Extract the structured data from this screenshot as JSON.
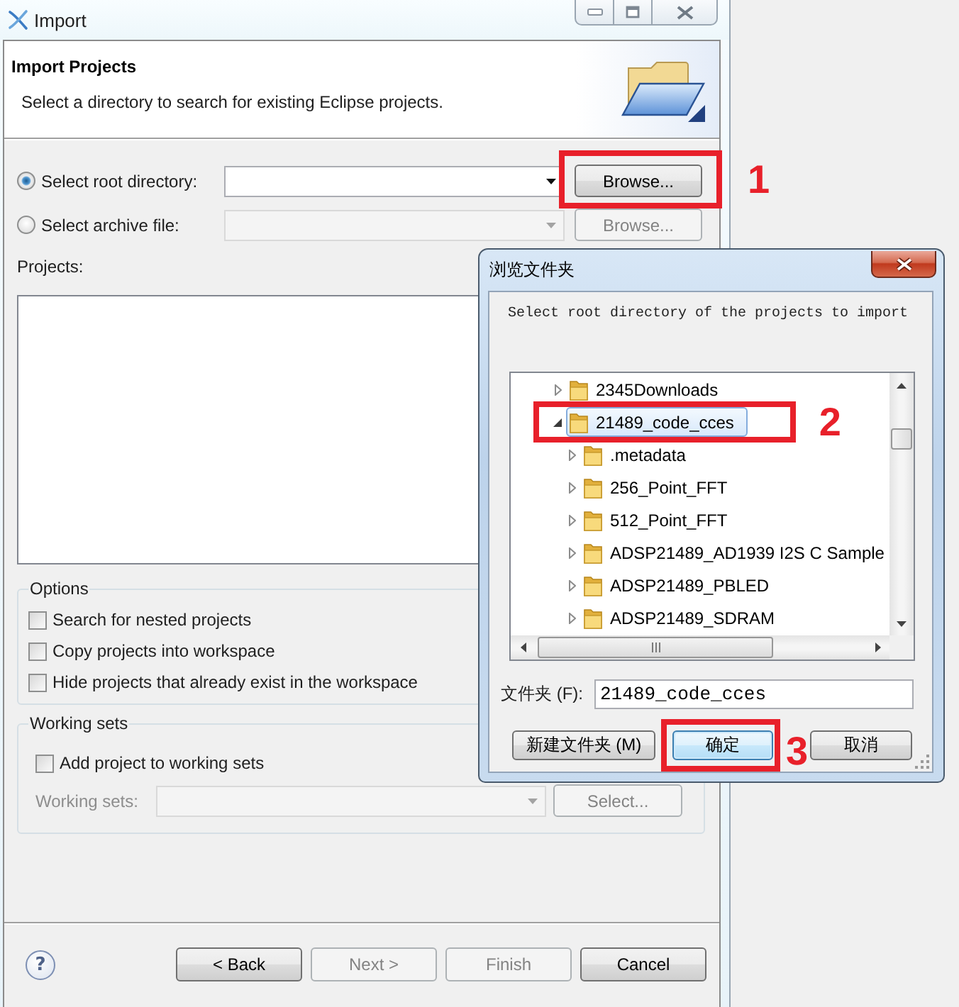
{
  "window": {
    "title": "Import"
  },
  "header": {
    "title": "Import Projects",
    "description": "Select a directory to search for existing Eclipse projects."
  },
  "sources": [
    {
      "label": "Select root directory:",
      "selected": true,
      "browse": {
        "label": "Browse...",
        "annotation": "1"
      }
    },
    {
      "label": "Select archive file:",
      "selected": false,
      "browse": {
        "label": "Browse..."
      }
    }
  ],
  "projects": {
    "label": "Projects:"
  },
  "options": {
    "title": "Options",
    "items": [
      {
        "label": "Search for nested projects",
        "checked": false
      },
      {
        "label": "Copy projects into workspace",
        "checked": false
      },
      {
        "label": "Hide projects that already exist in the workspace",
        "checked": false
      }
    ]
  },
  "working_sets": {
    "title": "Working sets",
    "add": {
      "label": "Add project to working sets",
      "checked": false
    },
    "field": {
      "label": "Working sets:",
      "disabled": true
    },
    "select": {
      "label": "Select...",
      "disabled": true
    }
  },
  "footer": {
    "help": "?",
    "buttons": [
      {
        "label": "< Back",
        "disabled": false
      },
      {
        "label": "Next >",
        "disabled": true
      },
      {
        "label": "Finish",
        "disabled": true
      },
      {
        "label": "Cancel",
        "disabled": false
      }
    ]
  },
  "browse_dialog": {
    "title": "浏览文件夹",
    "prompt": "Select root directory of the projects to import",
    "tree": [
      {
        "label": "2345Downloads",
        "expanded": false,
        "selected": false
      },
      {
        "label": "21489_code_cces",
        "expanded": true,
        "selected": true,
        "annotation": "2",
        "children": [
          {
            "label": ".metadata",
            "expanded": false,
            "selected": false
          },
          {
            "label": "256_Point_FFT",
            "expanded": false,
            "selected": false
          },
          {
            "label": "512_Point_FFT",
            "expanded": false,
            "selected": false
          },
          {
            "label": "ADSP21489_AD1939 I2S C Sample",
            "expanded": false,
            "selected": false
          },
          {
            "label": "ADSP21489_PBLED",
            "expanded": false,
            "selected": false
          },
          {
            "label": "ADSP21489_SDRAM",
            "expanded": false,
            "selected": false
          }
        ]
      }
    ],
    "folder_field": {
      "label": "文件夹 (F):",
      "value": "21489_code_cces"
    },
    "buttons": [
      {
        "label": "新建文件夹 (M)",
        "focused": false
      },
      {
        "label": "确定",
        "focused": true,
        "annotation": "3"
      },
      {
        "label": "取消",
        "focused": false
      }
    ]
  }
}
